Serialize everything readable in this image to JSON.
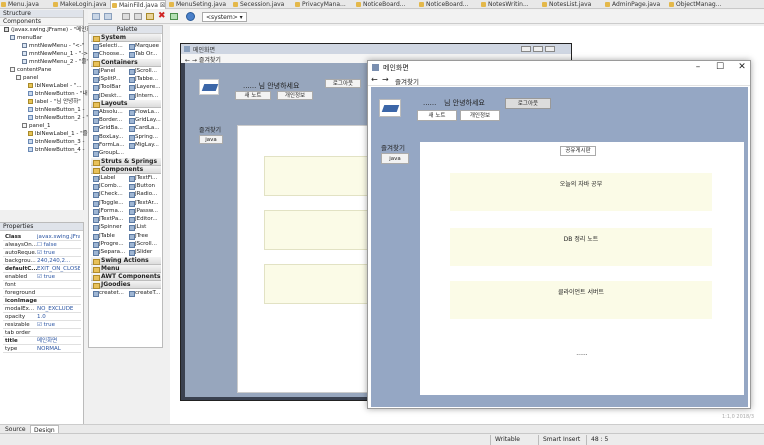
{
  "tabs": [
    {
      "label": "Menu.java"
    },
    {
      "label": "MakeLogin.java"
    },
    {
      "label": "MainFild.java ☒",
      "active": true
    },
    {
      "label": "MenuSeting.java"
    },
    {
      "label": "Secession.java"
    },
    {
      "label": "PrivacyMana..."
    },
    {
      "label": "NoticeBoard..."
    },
    {
      "label": "NoticeBoard..."
    },
    {
      "label": "NotesWritin..."
    },
    {
      "label": "NotesList.java"
    },
    {
      "label": "AdminPage.java"
    },
    {
      "label": "ObjectManag..."
    }
  ],
  "structure": {
    "title": "Structure",
    "components_label": "Components",
    "nodes": [
      {
        "label": "(javax.swing.JFrame) - \"메인화\"",
        "icon": "frame"
      },
      {
        "label": "menuBar",
        "icon": "menu"
      },
      {
        "label": "mntNewMenu - \"<-\"",
        "icon": "menu"
      },
      {
        "label": "mntNewMenu_1 - \"->\"",
        "icon": "menu"
      },
      {
        "label": "mntNewMenu_2 - \"즐\"",
        "icon": "menu"
      },
      {
        "label": "contentPane",
        "icon": "panel"
      },
      {
        "label": "panel",
        "icon": "panel"
      },
      {
        "label": "lblNewLabel - \"...",
        "icon": "label"
      },
      {
        "label": "btnNewButton - \"내",
        "icon": "button"
      },
      {
        "label": "label - \"님 안녕하\"",
        "icon": "label"
      },
      {
        "label": "btnNewButton_1 - ",
        "icon": "button"
      },
      {
        "label": "btnNewButton_2 - \"",
        "icon": "button"
      },
      {
        "label": "panel_1",
        "icon": "panel"
      },
      {
        "label": "lblNewLabel_1 - \"즐",
        "icon": "label"
      },
      {
        "label": "btnNewButton_3 - ",
        "icon": "button"
      },
      {
        "label": "btnNewButton_4 - ",
        "icon": "button"
      }
    ]
  },
  "properties": {
    "title": "Properties",
    "rows": [
      {
        "k": "Class",
        "v": "javax.swing.JFra...",
        "bold": true
      },
      {
        "k": "alwaysOn...",
        "v": "☐ false"
      },
      {
        "k": "autoReque...",
        "v": "☑ true"
      },
      {
        "k": "backgrou...",
        "v": "240,240,2..."
      },
      {
        "k": "defaultC...",
        "v": "EXIT_ON_CLOSE",
        "bold": true
      },
      {
        "k": "enabled",
        "v": "☑ true"
      },
      {
        "k": "font",
        "v": ""
      },
      {
        "k": "foreground",
        "v": ""
      },
      {
        "k": "iconImage",
        "v": "",
        "bold": true
      },
      {
        "k": "modalEx...",
        "v": "NO_EXCLUDE"
      },
      {
        "k": "opacity",
        "v": "1.0"
      },
      {
        "k": "resizable",
        "v": "☑ true"
      },
      {
        "k": "tab order",
        "v": ""
      },
      {
        "k": "title",
        "v": "메인화면",
        "bold": true
      },
      {
        "k": "type",
        "v": "NORMAL"
      }
    ]
  },
  "palette": {
    "title": "Palette",
    "system_label": "System",
    "system_items": [
      "Selecti...",
      "Marquee",
      "Choose...",
      "Tab Or..."
    ],
    "containers_label": "Containers",
    "container_items": [
      "JPanel",
      "JScroll...",
      "JSplitP...",
      "JTabbe...",
      "JToolBar",
      "JLayere...",
      "JDeskt...",
      "JIntern..."
    ],
    "layouts_label": "Layouts",
    "layout_items": [
      "Absolu...",
      "FlowLa...",
      "Border...",
      "GridLay...",
      "GridBa...",
      "CardLa...",
      "BoxLay...",
      "Spring...",
      "FormLa...",
      "MigLay...",
      "GroupL..."
    ],
    "struts_label": "Struts & Springs",
    "components_label": "Components",
    "component_items": [
      "JLabel",
      "JTextFi...",
      "JComb...",
      "JButton",
      "JCheck...",
      "JRadio...",
      "JToggle...",
      "JTextAr...",
      "JForma...",
      "JPassw...",
      "JTextPa...",
      "JEditor...",
      "JSpinner",
      "JList",
      "JTable",
      "JTree",
      "JProgre...",
      "JScroll...",
      "JSepara...",
      "JSlider"
    ],
    "swing_actions_label": "Swing Actions",
    "menu_label": "Menu",
    "awt_label": "AWT Components",
    "jgoodies_label": "JGoodies",
    "bottom_items": [
      "createt...",
      "createT..."
    ]
  },
  "design_frame": {
    "title": "메인화면",
    "menu": "← → 즐겨찾기",
    "greeting": "...... 님 안녕하세요",
    "logout": "로그아웃",
    "new_note": "새 노트",
    "profile": "개인정보",
    "favorites": "즐겨찾기",
    "java": "java"
  },
  "run_window": {
    "title": "메인화면",
    "menu_back": "←",
    "menu_forward": "→",
    "menu_fav": "즐겨찾기",
    "greeting_dots": "......",
    "greeting": "님 안녕하세요",
    "logout": "로그아웃",
    "new_note": "새 노트",
    "profile": "개인정보",
    "favorites": "즐겨찾기",
    "java": "java",
    "board_button": "공유게시판",
    "posts": [
      "오늘의 자바 공부",
      "DB 정리 노트",
      "클라이언트 서버트"
    ],
    "ellipsis": "......"
  },
  "bottom_tabs": {
    "source": "Source",
    "design": "Design"
  },
  "status": {
    "writable": "Writable",
    "insert": "Smart Insert",
    "position": "48 : 5"
  },
  "toolbar": {
    "system_label": "<system>"
  },
  "colors": {
    "run_bg": "#95a7c4",
    "design_bg": "#97a6bd",
    "post_bg": "#fbfbe7",
    "canvas": "#ffffff"
  }
}
